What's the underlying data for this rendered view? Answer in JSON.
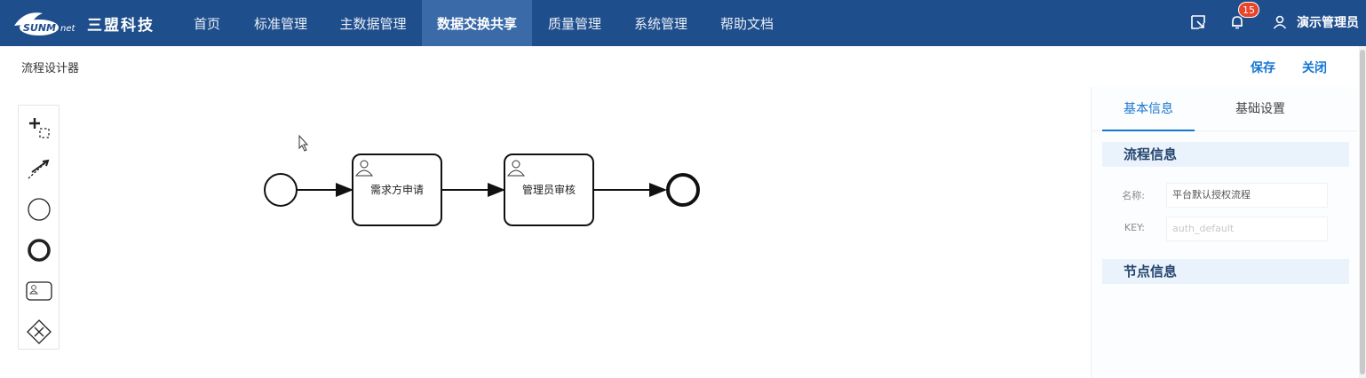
{
  "brand": {
    "logo_text": "SUNMnet",
    "company": "三盟科技"
  },
  "nav": {
    "items": [
      {
        "label": "首页"
      },
      {
        "label": "标准管理"
      },
      {
        "label": "主数据管理"
      },
      {
        "label": "数据交换共享"
      },
      {
        "label": "质量管理"
      },
      {
        "label": "系统管理"
      },
      {
        "label": "帮助文档"
      }
    ],
    "active_index": 3,
    "notification_count": "15",
    "user_name": "演示管理员"
  },
  "page": {
    "title": "流程设计器",
    "save_label": "保存",
    "close_label": "关闭"
  },
  "palette": {
    "tools": [
      "lasso-tool-icon",
      "connect-tool-icon",
      "start-event-icon",
      "end-event-icon",
      "user-task-icon",
      "exclusive-gateway-icon"
    ]
  },
  "diagram": {
    "tasks": [
      {
        "label": "需求方申请"
      },
      {
        "label": "管理员审核"
      }
    ]
  },
  "panel": {
    "tabs": [
      {
        "label": "基本信息"
      },
      {
        "label": "基础设置"
      }
    ],
    "active_tab": 0,
    "sections": {
      "process_info": "流程信息",
      "node_info": "节点信息"
    },
    "fields": {
      "name_label": "名称:",
      "name_value": "平台默认授权流程",
      "key_label": "KEY:",
      "key_placeholder": "auth_default"
    }
  },
  "colors": {
    "topbar": "#1f4e8c",
    "active_nav": "#3a6aa8",
    "accent": "#1677d2",
    "badge": "#e8442c"
  }
}
